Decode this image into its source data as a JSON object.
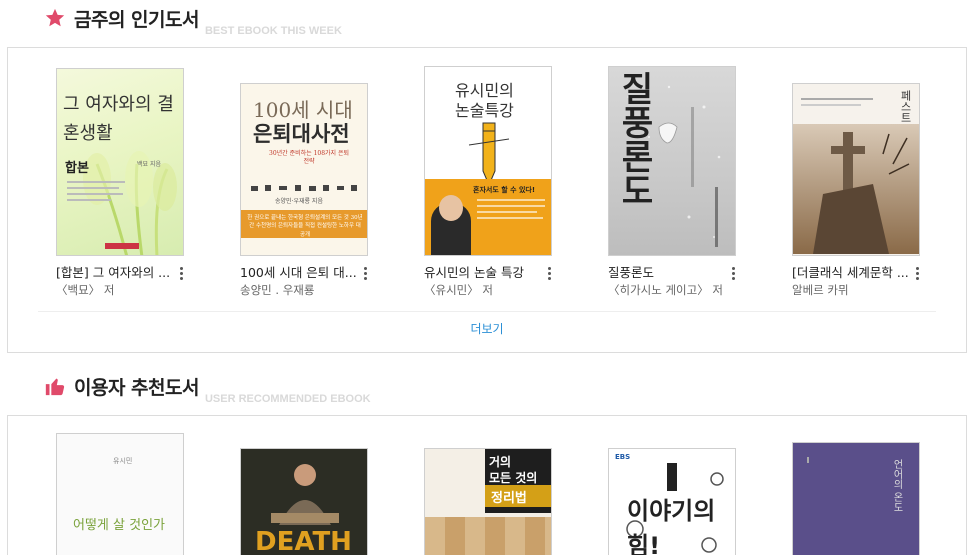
{
  "best_section": {
    "title": "금주의 인기도서",
    "subtitle": "BEST EBOOK THIS WEEK",
    "icon": "star-icon",
    "accent": "#e04a6a",
    "more_label": "더보기",
    "books": [
      {
        "title": "[합본] 그 여자와의 ...",
        "author": "〈백묘〉 저",
        "cover_main": "그 여자와의 결혼생활",
        "cover_tag": "합본",
        "cover_small": "백묘 지음"
      },
      {
        "title": "100세 시대 은퇴 대...",
        "author": "송양민 . 우재룡",
        "cover_line1": "100세 시대",
        "cover_line2": "은퇴대사전",
        "cover_small": "30년간 준비하는 108가지 은퇴전략",
        "cover_authors": "송양민·우재룡 지음",
        "cover_band": "한 권으로 끝내는 한국형 은퇴설계의 모든 것 30년간 수천명의 은퇴자들을 직접 컨설팅한 노하우 대공개"
      },
      {
        "title": "유시민의 논술 특강",
        "author": "〈유시민〉 저",
        "cover_line1": "유시민의",
        "cover_line2": "논술특강",
        "cover_band": "혼자서도 할 수 있다!"
      },
      {
        "title": "질풍론도",
        "author": "〈히가시노 게이고〉 저",
        "cover_main": "질풍론도"
      },
      {
        "title": "[더클래식 세계문학 ...",
        "author": "알베르 카뮈",
        "cover_main": "페스트"
      }
    ]
  },
  "rec_section": {
    "title": "이용자 추천도서",
    "subtitle": "USER RECOMMENDED EBOOK",
    "icon": "thumbs-up-icon",
    "accent": "#e04a6a",
    "books": [
      {
        "cover_main": "어떻게 살 것인가",
        "cover_small": "유시민"
      },
      {
        "cover_main": "DEATH"
      },
      {
        "cover_line1": "거의",
        "cover_line2": "모든 것의",
        "cover_line3": "정리법"
      },
      {
        "cover_main": "이야기의 힘!",
        "cover_tag": "EBS"
      },
      {
        "cover_main": "언어의 온도"
      }
    ]
  }
}
